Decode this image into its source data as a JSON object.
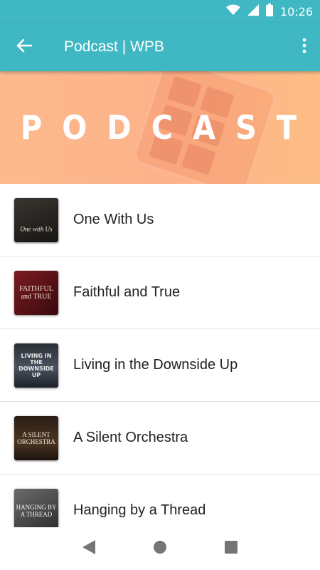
{
  "status": {
    "time": "10:26",
    "icons": [
      "wifi-icon",
      "signal-icon",
      "battery-icon"
    ]
  },
  "appbar": {
    "title": "Podcast | WPB",
    "back_icon": "arrow-left-icon",
    "menu_icon": "more-vert-icon"
  },
  "banner": {
    "title": "PODCAST"
  },
  "podcasts": [
    {
      "title": "One With Us",
      "cover_text": "One with Us"
    },
    {
      "title": "Faithful and True",
      "cover_text": "FAITHFUL and TRUE"
    },
    {
      "title": "Living in the Downside Up",
      "cover_text": "LIVING IN THE DOWNSIDE UP"
    },
    {
      "title": "A Silent Orchestra",
      "cover_text": "A SILENT ORCHESTRA"
    },
    {
      "title": "Hanging by a Thread",
      "cover_text": "HANGING BY A THREAD"
    }
  ],
  "navbar": {
    "icons": [
      "back-triangle-icon",
      "home-circle-icon",
      "recents-square-icon"
    ]
  },
  "colors": {
    "primary": "#3fb8c4",
    "banner": "#fdb98c"
  }
}
